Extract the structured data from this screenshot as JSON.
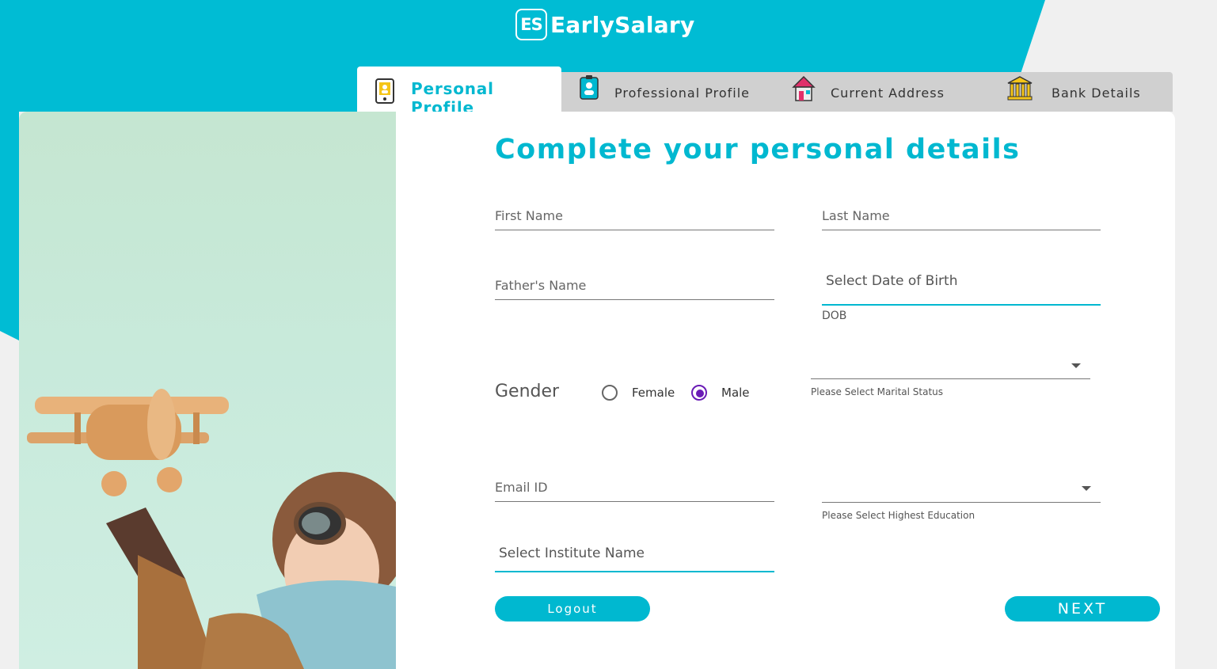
{
  "brand": {
    "mark": "ES",
    "name": "EarlySalary",
    "accent": "#00b8d0",
    "radio_color": "#6a1bb6"
  },
  "tabs": [
    {
      "label": "Personal Profile",
      "icon": "mobile-id-icon",
      "active": true
    },
    {
      "label": "Professional Profile",
      "icon": "id-badge-icon",
      "active": false
    },
    {
      "label": "Current Address",
      "icon": "house-icon",
      "active": false
    },
    {
      "label": "Bank Details",
      "icon": "bank-icon",
      "active": false
    }
  ],
  "form": {
    "heading": "Complete your personal details",
    "first_name": {
      "placeholder": "First Name",
      "value": ""
    },
    "last_name": {
      "placeholder": "Last Name",
      "value": ""
    },
    "father_name": {
      "placeholder": "Father's Name",
      "value": ""
    },
    "dob": {
      "placeholder": "Select Date of Birth",
      "helper": "DOB",
      "value": ""
    },
    "gender": {
      "label": "Gender",
      "options": [
        "Female",
        "Male"
      ],
      "selected": "Male"
    },
    "marital_status": {
      "value": "",
      "helper": "Please Select Marital Status"
    },
    "email": {
      "placeholder": "Email ID",
      "value": ""
    },
    "education": {
      "value": "",
      "helper": "Please Select Highest Education"
    },
    "institute": {
      "placeholder": "Select Institute Name",
      "value": ""
    }
  },
  "buttons": {
    "logout": "Logout",
    "next": "NEXT"
  },
  "image": {
    "subject": "child-with-toy-airplane-photo"
  }
}
